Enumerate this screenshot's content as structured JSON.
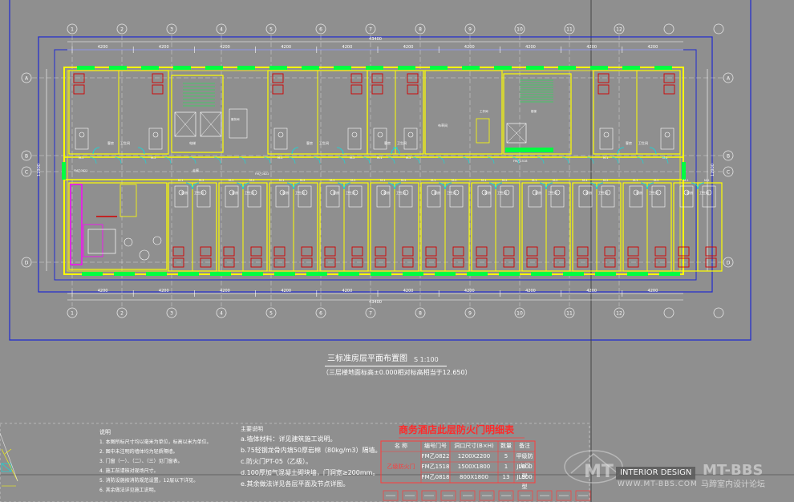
{
  "drawing": {
    "title": "三标准房层平面布置图",
    "scale": "S 1:100",
    "subtitle": "（三层楼地面标高±0.000相对标高相当于12.650）"
  },
  "general_notes": {
    "heading": "说明",
    "items": [
      "1. 本图所标尺寸均以毫米为单位，标高以米为单位。",
      "2. 图中未注明的墙体均为轻质隔墙。",
      "3. 门窗（一）、（二）、（三）见门窗表。",
      "4. 施工前请核对现场尺寸。",
      "5. 消防设施按消防规范设置，12层以下详见。",
      "6. 其余做法详见施工说明。"
    ]
  },
  "material_notes": {
    "heading": "主要说明",
    "items": [
      "a.墙体材料：详见建筑施工说明。",
      "b.75轻钢龙骨内填50厚岩棉（80kg/m3）隔墙。",
      "c.防火门PT-05（乙级）。",
      "d.100厚加气混凝土砌块墙，门洞宽≥200mm。",
      "e.其余做法详见各层平面及节点详图。"
    ]
  },
  "door_schedule": {
    "title": "商务酒店此层防火门明细表",
    "headers": [
      "名    称",
      "编号门号",
      "洞口尺寸(B×H)",
      "数量",
      "备注"
    ],
    "group_label": "乙级防火门",
    "rows": [
      {
        "code": "FM乙0822",
        "size": "1200X2200",
        "qty": "5",
        "note": "甲级防火门"
      },
      {
        "code": "FM乙1518",
        "size": "1500X1800",
        "qty": "1",
        "note": "JL800型"
      },
      {
        "code": "FM乙0818",
        "size": "800X1800",
        "qty": "13",
        "note": "JL800型"
      }
    ]
  },
  "dimensions": {
    "overall_top": "43400",
    "overall_bottom": "43400",
    "bay_top": [
      "4200",
      "4200",
      "4200",
      "4200",
      "4200",
      "4200",
      "4200",
      "4200",
      "4200",
      "4200"
    ],
    "bay_bottom": [
      "4200",
      "4200",
      "4200",
      "4200",
      "4200",
      "4200",
      "4200",
      "4200",
      "4200",
      "4200"
    ],
    "depth_left": "12900",
    "depth_right": "12900"
  },
  "axis_labels": {
    "top": [
      "1",
      "2",
      "3",
      "4",
      "5",
      "6",
      "7",
      "8",
      "9",
      "10",
      "11",
      "12"
    ],
    "bottom": [
      "1",
      "2",
      "3",
      "4",
      "5",
      "6",
      "7",
      "8",
      "9",
      "10",
      "11",
      "12"
    ],
    "left": [
      "A",
      "B",
      "C",
      "D"
    ],
    "right": [
      "A",
      "B",
      "C",
      "D"
    ]
  },
  "room_labels": {
    "elevator": "电梯",
    "stair": "楼梯",
    "corridor": "走廊",
    "guestroom": "客房",
    "bath": "卫生间",
    "linen": "布草间",
    "service": "服务间",
    "pantry": "工作间"
  },
  "door_tags": {
    "corridor": "FM乙0822",
    "stair": "FM乙1518",
    "room": "M-1",
    "bath": "M-2"
  },
  "watermark": {
    "left": "MT",
    "badge": "INTERIOR DESIGN",
    "right": "MT-BBS",
    "url": "WWW.MT-BBS.COM",
    "cn": "马蹄室内设计论坛"
  },
  "colors": {
    "background": "#8f8f8f",
    "wall": "#ffff00",
    "window": "#00ff40",
    "furniture": "#d40000",
    "axis": "#e6e6e6",
    "dimension": "#ffffff",
    "sheet_border": "#1f2ad0",
    "title_red": "#ff2a2a",
    "cyan": "#00e5e5",
    "magenta": "#ff00ff"
  }
}
